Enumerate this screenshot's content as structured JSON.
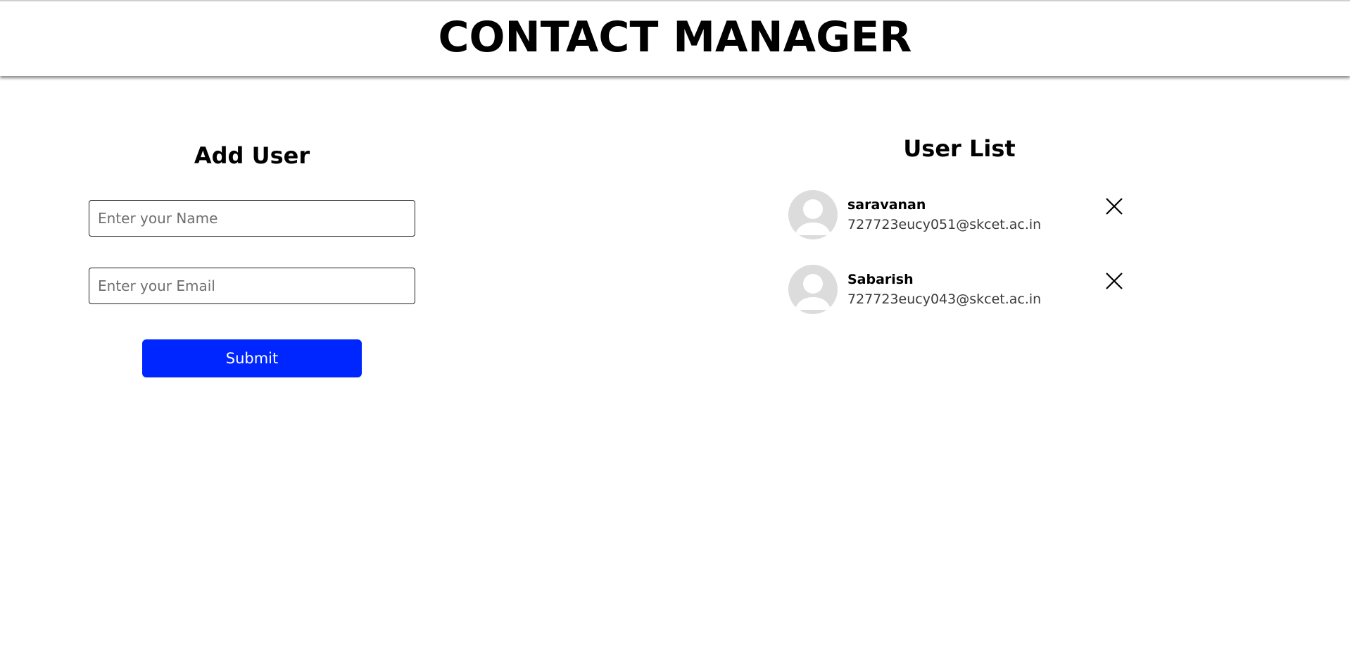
{
  "header": {
    "title": "CONTACT MANAGER"
  },
  "add_user": {
    "title": "Add User",
    "name_placeholder": "Enter your Name",
    "email_placeholder": "Enter your Email",
    "submit_label": "Submit"
  },
  "user_list": {
    "title": "User List",
    "users": [
      {
        "name": "saravanan",
        "email": "727723eucy051@skcet.ac.in",
        "avatar_icon": "default-avatar-icon",
        "delete_icon": "close-icon"
      },
      {
        "name": "Sabarish",
        "email": "727723eucy043@skcet.ac.in",
        "avatar_icon": "default-avatar-icon",
        "delete_icon": "close-icon"
      }
    ]
  },
  "colors": {
    "submit_button": "#0026ff",
    "avatar_background": "#dcdcdc",
    "avatar_figure": "#ffffff"
  }
}
